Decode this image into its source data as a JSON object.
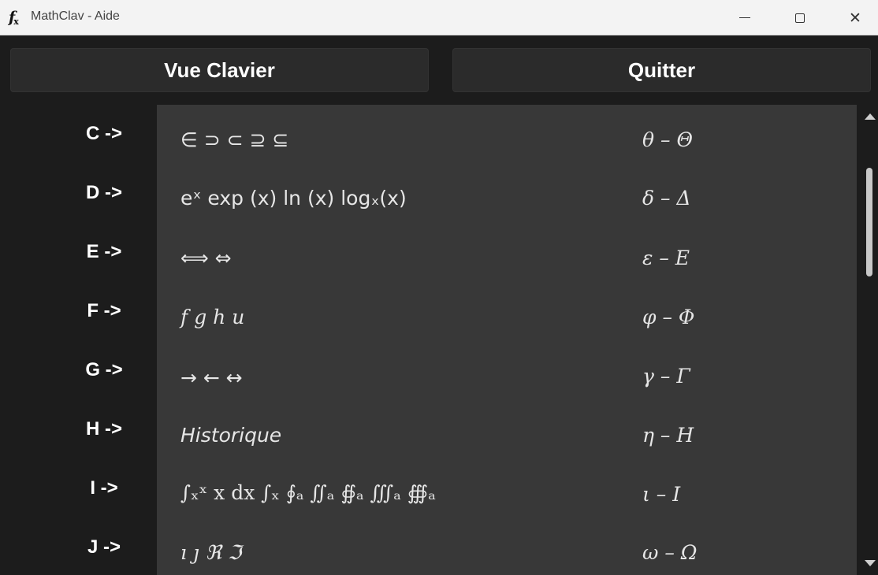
{
  "window": {
    "title": "MathClav - Aide",
    "icon": "fx-icon",
    "icon_text": "f",
    "icon_sub": "x",
    "close_glyph": "✕"
  },
  "buttons": {
    "view_keyboard": "Vue Clavier",
    "quit": "Quitter"
  },
  "rows": [
    {
      "key": "C ->",
      "symbols": "∈   ⊃   ⊂   ⊇   ⊆",
      "greek": "θ – Θ"
    },
    {
      "key": "D ->",
      "symbols": "eˣ  exp (x)  ln (x)  logₓ(x)",
      "greek": "δ – Δ"
    },
    {
      "key": "E ->",
      "symbols": "⟺   ⇔",
      "greek": "ε – E"
    },
    {
      "key": "F ->",
      "symbols": "f  g  h  u",
      "greek": "φ – Φ"
    },
    {
      "key": "G ->",
      "symbols": "→   ←   ↔",
      "greek": "γ – Γ"
    },
    {
      "key": "H ->",
      "symbols": "Historique",
      "greek": "η – H"
    },
    {
      "key": "I ->",
      "symbols": "∫ₓˣ x dx   ∫ₓ   ∮ₐ   ∬ₐ   ∯ₐ   ∭ₐ   ∰ₐ",
      "greek": "ι – I"
    },
    {
      "key": "J ->",
      "symbols": "ı  ȷ  ℜ  ℑ",
      "greek": "ω – Ω"
    }
  ]
}
